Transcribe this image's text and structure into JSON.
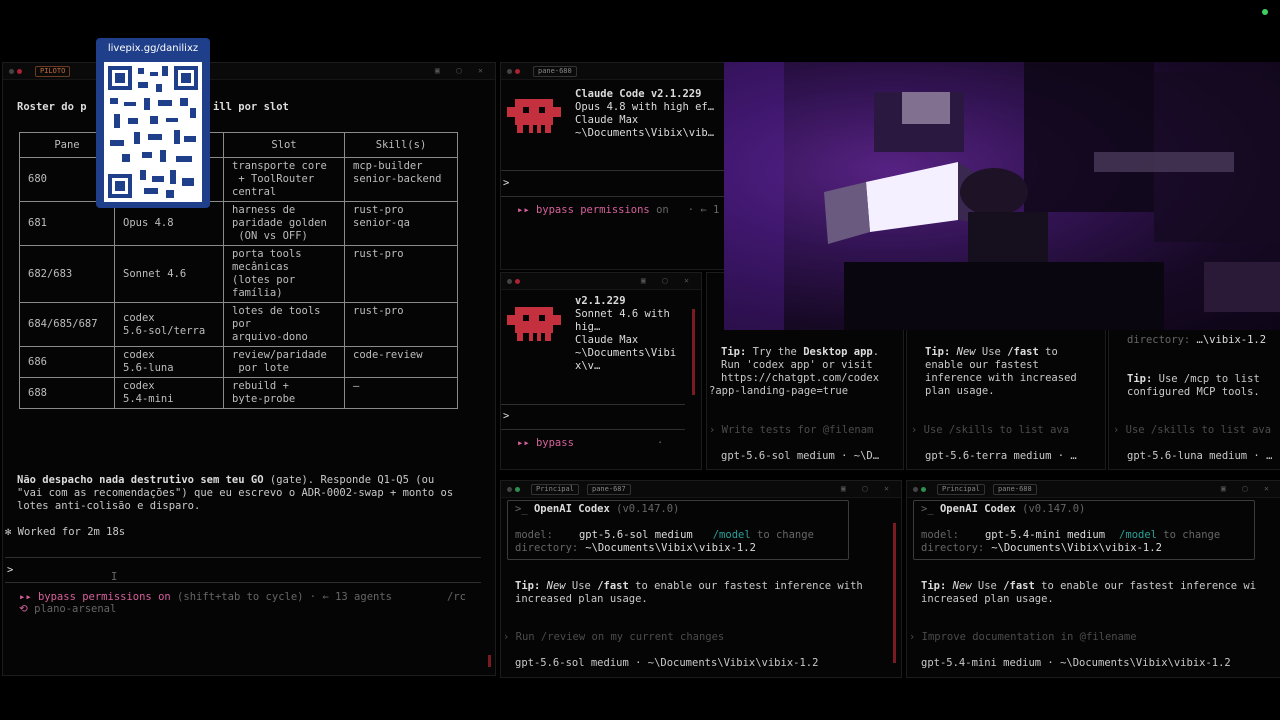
{
  "overlay": {
    "livepix": "livepix.gg/danilixz"
  },
  "left_pane": {
    "tab_label": "PILOTO",
    "heading_a": "Roster do p",
    "heading_b": "ill por slot",
    "table": {
      "headers": [
        "Pane",
        "",
        "Slot",
        "Skill(s)"
      ],
      "rows": [
        [
          "680",
          "",
          "transporte core\n + ToolRouter\ncentral",
          "mcp-builder\nsenior-backend"
        ],
        [
          "681",
          "Opus 4.8",
          "harness de\nparidade golden\n (ON vs OFF)",
          "rust-pro\nsenior-qa"
        ],
        [
          "682/683",
          "Sonnet 4.6",
          "porta tools\nmecânicas\n(lotes por\nfamília)",
          "rust-pro"
        ],
        [
          "684/685/687",
          "codex\n5.6-sol/terra",
          "lotes de tools\npor\narquivo-dono",
          "rust-pro"
        ],
        [
          "686",
          "codex\n5.6-luna",
          "review/paridade\n por lote",
          "code-review"
        ],
        [
          "688",
          "codex\n5.4-mini",
          "rebuild +\nbyte-probe",
          "—"
        ]
      ]
    },
    "msg_bold": "Não despacho nada destrutivo sem teu GO",
    "msg_rest": " (gate). Responde Q1-Q5 (ou",
    "msg_line2": "\"vai com as recomendações\") que eu escrevo o ADR-0002-swap + monto os",
    "msg_line3": "lotes anti-colisão e disparo.",
    "worked": "Worked for 2m 18s",
    "prompt": ">",
    "status_bypass": "bypass permissions",
    "status_on": " on",
    "status_rest": " (shift+tab to cycle) · ← 13 agents",
    "status_rc": "/rc",
    "session": "plano-arsenal"
  },
  "claude_top": {
    "tab_label": "pane-680",
    "line1": "Claude Code v2.1.229",
    "line2": "Opus 4.8 with high ef…",
    "line3": "Claude Max",
    "line4": "~\\Documents\\Vibix\\vib…",
    "prompt": ">",
    "status_bypass": "bypass permissions",
    "status_rest": " on   · ← 1"
  },
  "claude_mid": {
    "line1": "v2.1.229",
    "line2": "Sonnet 4.6 with",
    "line3": "hig…",
    "line4": "Claude Max",
    "line5": "~\\Documents\\Vibi",
    "line6": "x\\v…",
    "prompt": ">",
    "status_bypass": "bypass",
    "status_dot": "·"
  },
  "codex_small_1": {
    "tip_label": "Tip:",
    "tip_a": " Try the ",
    "tip_bold": "Desktop app",
    "tip_b": ".",
    "tip_l2": "Run 'codex app' or visit",
    "tip_l3": "https://chatgpt.com/codex",
    "tip_l4": "?app-landing-page=true",
    "hint": "› Write tests for @filenam",
    "model": "gpt-5.6-sol medium · ~\\D…"
  },
  "codex_small_2": {
    "tip_label": "Tip:",
    "tip_new": " New",
    "tip_a": " Use ",
    "tip_cmd": "/fast",
    "tip_b": " to",
    "tip_l2": "enable our fastest",
    "tip_l3": "inference with increased",
    "tip_l4": "plan usage.",
    "hint": "› Use /skills to list ava",
    "model": "gpt-5.6-terra medium · …"
  },
  "codex_small_3": {
    "dir_label": "directory:",
    "dir_value": " …\\vibix-1.2",
    "tip_label": "Tip:",
    "tip_a": " Use /mcp to list",
    "tip_l2": "configured MCP tools.",
    "hint": "› Use /skills to list ava",
    "model": "gpt-5.6-luna medium · …"
  },
  "codex_bottom_1": {
    "tab_a": "Principal",
    "tab_b": "pane-687",
    "title": "OpenAI Codex",
    "version": " (v0.147.0)",
    "model_label": "model:",
    "model_value": "gpt-5.6-sol medium",
    "model_cmd": "/model",
    "model_change": " to change",
    "dir_label": "directory:",
    "dir_value": "~\\Documents\\Vibix\\vibix-1.2",
    "tip_label": "Tip:",
    "tip_new": " New",
    "tip_a": " Use ",
    "tip_cmd": "/fast",
    "tip_b": " to enable our fastest inference with",
    "tip_l2": "increased plan usage.",
    "hint": "› Run /review on my current changes",
    "status": "gpt-5.6-sol medium · ~\\Documents\\Vibix\\vibix-1.2"
  },
  "codex_bottom_2": {
    "tab_a": "Principal",
    "tab_b": "pane-688",
    "title": "OpenAI Codex",
    "version": " (v0.147.0)",
    "model_label": "model:",
    "model_value": "gpt-5.4-mini medium",
    "model_cmd": "/model",
    "model_change": " to change",
    "dir_label": "directory:",
    "dir_value": "~\\Documents\\Vibix\\vibix-1.2",
    "tip_label": "Tip:",
    "tip_new": " New",
    "tip_a": " Use ",
    "tip_cmd": "/fast",
    "tip_b": " to enable our fastest inference wi",
    "tip_l2": "increased plan usage.",
    "hint": "› Improve documentation in @filename",
    "status": "gpt-5.4-mini medium · ~\\Documents\\Vibix\\vibix-1.2"
  },
  "colors": {
    "accent_pink": "#d6609b",
    "brand_red": "#c5303f",
    "teal": "#2aa198",
    "qr_card": "#1f3f8a"
  }
}
